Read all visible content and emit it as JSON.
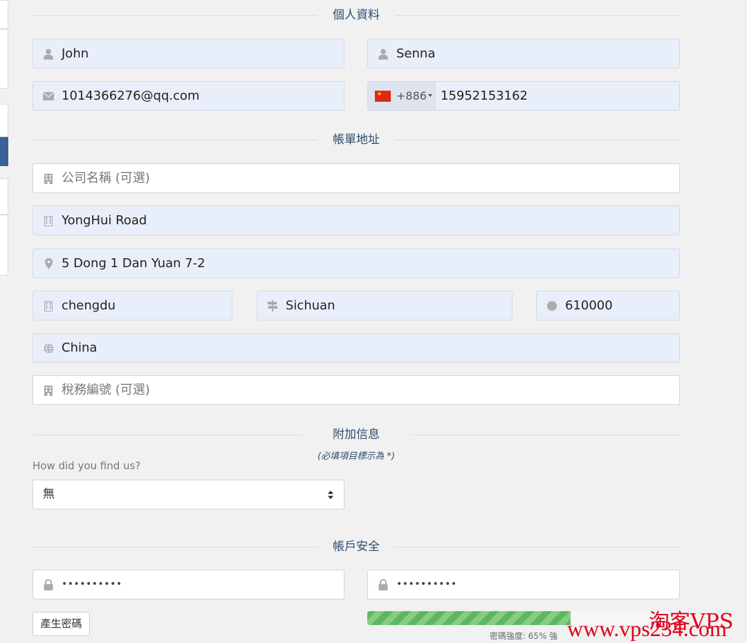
{
  "sections": {
    "personal": "個人資料",
    "billing": "帳單地址",
    "additional": "附加信息",
    "security": "帳戶安全"
  },
  "personal": {
    "first_name": "John",
    "last_name": "Senna",
    "email": "1014366276@qq.com",
    "phone_country_code": "+886",
    "phone_number": "15952153162"
  },
  "billing": {
    "company_placeholder": "公司名稱 (可選)",
    "address1": "YongHui Road",
    "address2": "5 Dong 1 Dan Yuan 7-2",
    "city": "chengdu",
    "state": "Sichuan",
    "postcode": "610000",
    "country": "China",
    "tax_id_placeholder": "稅務編號 (可選)"
  },
  "additional": {
    "required_note": "(必填項目標示為 *)",
    "how_found_label": "How did you find us?",
    "how_found_value": "無"
  },
  "security": {
    "password_mask": "••••••••••",
    "confirm_mask": "••••••••••",
    "generate_button": "產生密碼",
    "strength_percent": 65,
    "strength_text": "密碼強度: 65% 強"
  },
  "watermark": {
    "brand": "淘客VPS",
    "url": "www.vps234.com"
  },
  "colors": {
    "input_filled_bg": "#e8eefa",
    "section_title": "#2d4d6e",
    "strength_bar": "#5cb85c",
    "watermark": "#e0001b"
  },
  "icons": [
    "user-icon",
    "envelope-icon",
    "china-flag-icon",
    "building-icon",
    "map-marker-icon",
    "signpost-icon",
    "certificate-icon",
    "globe-icon",
    "lock-icon",
    "select-arrows-icon"
  ]
}
